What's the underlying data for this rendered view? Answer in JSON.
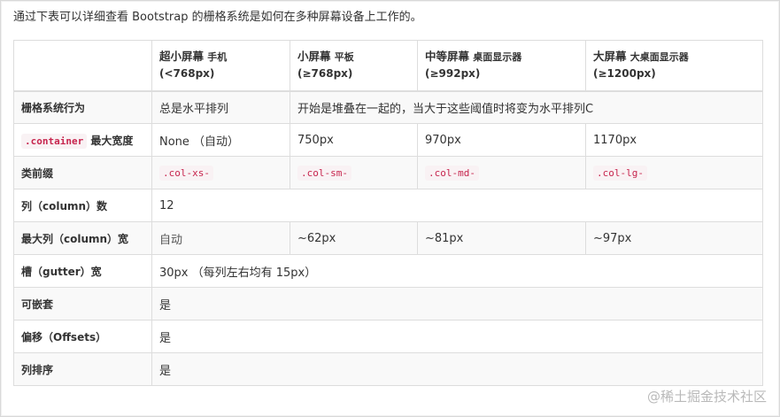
{
  "intro": "通过下表可以详细查看 Bootstrap 的栅格系统是如何在多种屏幕设备上工作的。",
  "header": [
    {
      "main": "",
      "sub": "",
      "range": ""
    },
    {
      "main": "超小屏幕",
      "sub": "手机",
      "range": "(<768px)"
    },
    {
      "main": "小屏幕",
      "sub": "平板",
      "range": "(≥768px)"
    },
    {
      "main": "中等屏幕",
      "sub": "桌面显示器",
      "range": "(≥992px)"
    },
    {
      "main": "大屏幕",
      "sub": "大桌面显示器",
      "range": "(≥1200px)"
    }
  ],
  "rows": {
    "grid": {
      "label": "栅格系统行为",
      "xs": "总是水平排列",
      "rest": "开始是堆叠在一起的，当大于这些阈值时将变为水平排列C"
    },
    "container": {
      "code": ".container",
      "label": "最大宽度",
      "xs": "None （自动）",
      "sm": "750px",
      "md": "970px",
      "lg": "1170px"
    },
    "prefix": {
      "label": "类前缀",
      "xs": ".col-xs-",
      "sm": ".col-sm-",
      "md": ".col-md-",
      "lg": ".col-lg-"
    },
    "columns": {
      "label": "列（column）数",
      "value": "12"
    },
    "colwidth": {
      "label": "最大列（column）宽",
      "xs": "自动",
      "sm": "~62px",
      "md": "~81px",
      "lg": "~97px"
    },
    "gutter": {
      "label": "槽（gutter）宽",
      "value": "30px （每列左右均有 15px）"
    },
    "nest": {
      "label": "可嵌套",
      "value": "是"
    },
    "offsets": {
      "label": "偏移（Offsets）",
      "value": "是"
    },
    "order": {
      "label": "列排序",
      "value": "是"
    }
  },
  "watermark": "@稀土掘金技术社区"
}
